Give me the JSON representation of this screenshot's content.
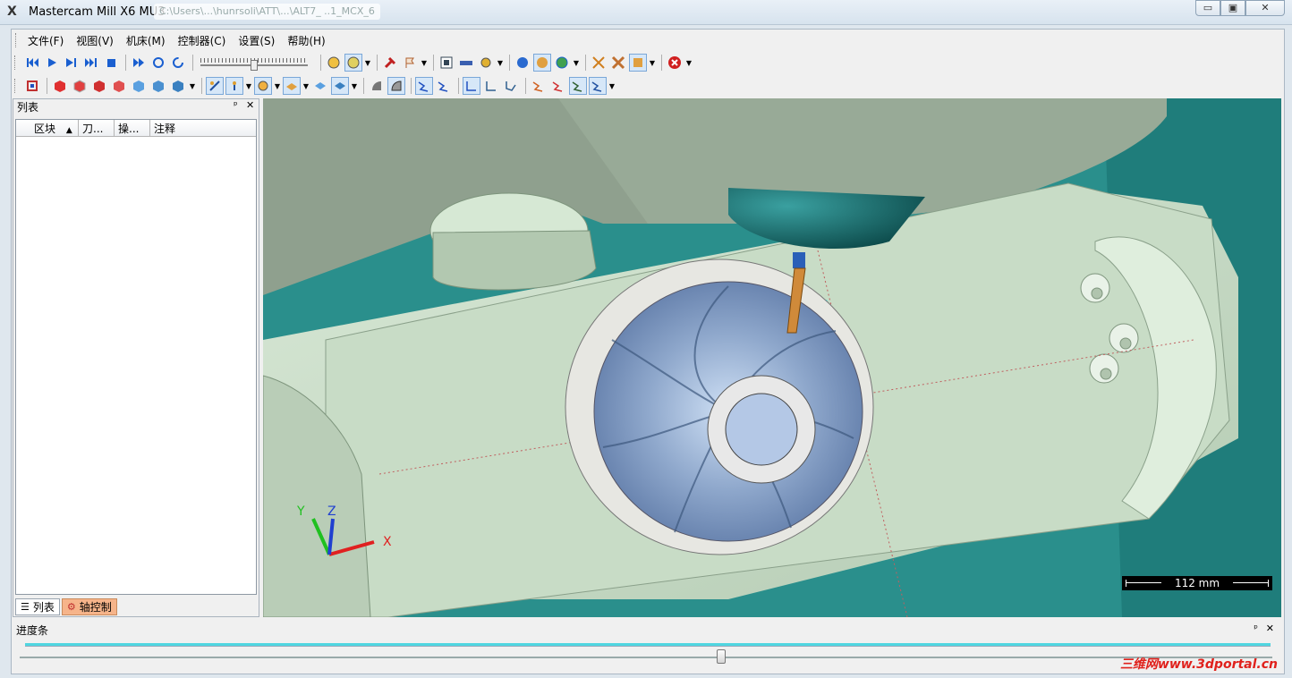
{
  "window": {
    "title": "Mastercam Mill X6 MU3",
    "path": "C:\\Users\\...\\hunrsoli\\ATT\\...\\ALT7_ ..1_MCX_6",
    "min_glyph": "▭",
    "max_glyph": "▣",
    "close_glyph": "✕"
  },
  "menu": [
    "文件(F)",
    "视图(V)",
    "机床(M)",
    "控制器(C)",
    "设置(S)",
    "帮助(H)"
  ],
  "list_panel": {
    "title": "列表",
    "pin_glyph": "ᵖ",
    "close_glyph": "✕",
    "columns": [
      "区块",
      "刀...",
      "操...",
      "注释"
    ],
    "sort_glyph": "▲",
    "tabs": {
      "list": "列表",
      "axis": "轴控制"
    }
  },
  "viewport": {
    "scale_label": "112 mm",
    "axes": {
      "x": "X",
      "y": "Y",
      "z": "Z"
    }
  },
  "progress_panel": {
    "title": "进度条",
    "pin_glyph": "ᵖ",
    "close_glyph": "✕",
    "progress": 1.0,
    "slider_position": 0.56
  },
  "watermark": "三维网www.3dportal.cn",
  "colors": {
    "viewport_bg": "#2a8f8c",
    "machine_body": "#c9dcc8",
    "tool_shank": "#d08a3a",
    "toolpath": "#4fd6e0",
    "axis_x": "#e02020",
    "axis_y": "#20c020",
    "axis_z": "#2040d0"
  }
}
